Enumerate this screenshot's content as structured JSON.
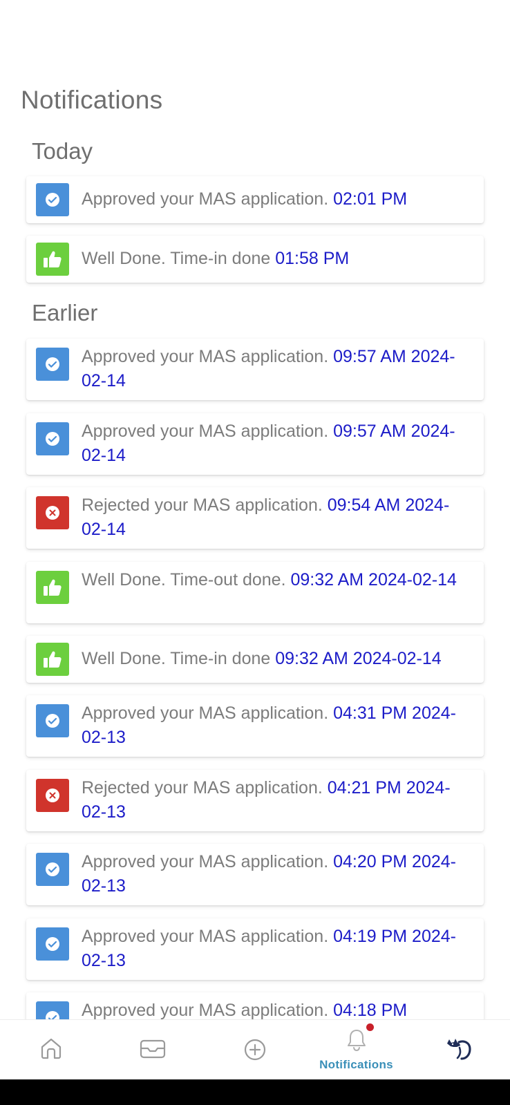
{
  "header": {
    "title": "Notifications"
  },
  "sections": {
    "today": "Today",
    "earlier": "Earlier"
  },
  "notifications": [
    {
      "message": "Approved your MAS application.",
      "time": "02:01 PM"
    },
    {
      "message": "Well Done. Time-in done",
      "time": "01:58 PM"
    },
    {
      "message": "Approved your MAS application.",
      "time": "09:57 AM 2024-02-14"
    },
    {
      "message": "Approved your MAS application.",
      "time": "09:57 AM 2024-02-14"
    },
    {
      "message": "Rejected your MAS application.",
      "time": "09:54 AM 2024-02-14"
    },
    {
      "message": "Well Done. Time-out done.",
      "time": "09:32 AM 2024-02-14"
    },
    {
      "message": "Well Done. Time-in done",
      "time": "09:32 AM 2024-02-14"
    },
    {
      "message": "Approved your MAS application.",
      "time": "04:31 PM 2024-02-13"
    },
    {
      "message": "Rejected your MAS application.",
      "time": "04:21 PM 2024-02-13"
    },
    {
      "message": "Approved your MAS application.",
      "time": "04:20 PM 2024-02-13"
    },
    {
      "message": "Approved your MAS application.",
      "time": "04:19 PM 2024-02-13"
    },
    {
      "message": "Approved your MAS application.",
      "time": "04:18 PM"
    }
  ],
  "nav": {
    "notifications_label": "Notifications"
  },
  "colors": {
    "approved": "#4a90d9",
    "rejected": "#d0342c",
    "welldone": "#6ccf3e",
    "time_text": "#1c1cc8",
    "nav_active": "#3a8fb8",
    "badge": "#c8202a"
  }
}
